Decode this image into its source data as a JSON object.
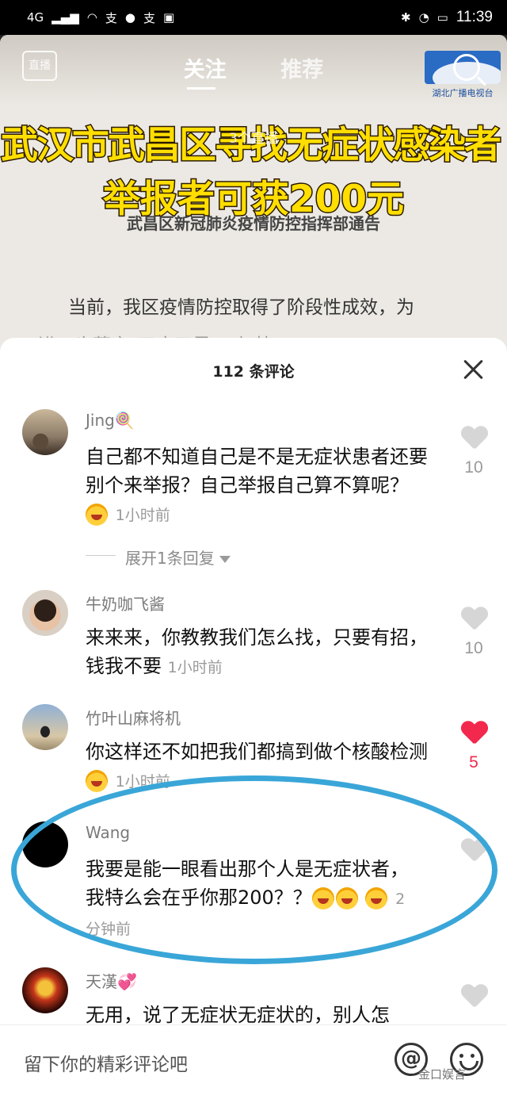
{
  "status_bar": {
    "left_icons": [
      "4G",
      "signal-icon",
      "wifi-icon",
      "alipay-icon",
      "chat-icon",
      "alipay-icon",
      "app-icon"
    ],
    "network": "4G",
    "time": "11:39"
  },
  "video": {
    "live_label": "直播",
    "tabs": [
      {
        "label": "关注",
        "active": true
      },
      {
        "label": "推荐",
        "active": false
      }
    ],
    "station_name": "湖北广播电视台",
    "headline_line1": "武汉市武昌区寻找无症状感染者",
    "headline_line2": "举报者可获200元",
    "live_count": "3个直播",
    "notice_subtitle": "武昌区新冠肺炎疫情防控指挥部通告",
    "notice_body": "当前，我区疫情防控取得了阶段性成效，为",
    "notice_body_cut": "进一步落实\"四应四尽\"，加快..."
  },
  "comments_panel": {
    "title": "112 条评论",
    "comments": [
      {
        "user": "Jing🍭",
        "text": "自己都不知道自己是不是无症状患者还要别个来举报？自己举报自己算不算呢？",
        "emoji": true,
        "time": "1小时前",
        "likes": "10",
        "liked": false
      },
      {
        "user": "牛奶咖飞酱",
        "text": "来来来，你教教我们怎么找，只要有招，钱我不要",
        "emoji": false,
        "time": "1小时前",
        "likes": "10",
        "liked": false
      },
      {
        "user": "竹叶山麻将机",
        "text": "你这样还不如把我们都搞到做个核酸检测",
        "emoji": true,
        "time": "1小时前",
        "likes": "5",
        "liked": true
      },
      {
        "user": "Wang",
        "text": "我要是能一眼看出那个人是无症状者，我特么会在乎你那200？？",
        "emoji": true,
        "time": "2分钟前",
        "likes": "",
        "liked": false
      },
      {
        "user": "天漢💞",
        "text": "无用，说了无症状无症状的，别人怎",
        "emoji": false,
        "time": "",
        "likes": "",
        "liked": false
      }
    ],
    "expand_replies": "展开1条回复"
  },
  "input_bar": {
    "placeholder": "留下你的精彩评论吧",
    "watermark": "金口娱言"
  },
  "colors": {
    "like_red": "#f2284d",
    "highlight_blue": "#3aa6d8",
    "headline_yellow": "#ffde00"
  }
}
